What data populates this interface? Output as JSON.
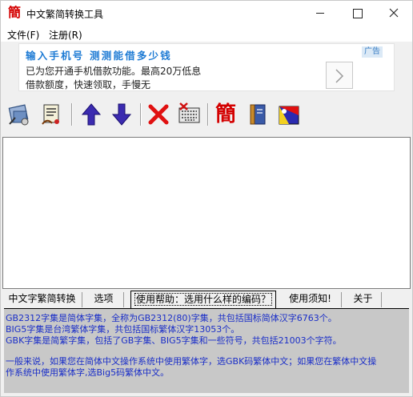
{
  "window": {
    "title": "中文繁简转换工具",
    "app_icon_glyph": "簡"
  },
  "menu": {
    "file": "文件(F)",
    "register": "注册(R)"
  },
  "ad": {
    "headline": "输入手机号  测测能借多少钱",
    "line1": "已为您开通手机借款功能。最高20万低息",
    "line2": "借款额度，快速领取，手慢无",
    "tag": "广告"
  },
  "toolbar": {
    "icons": [
      "open-file-icon",
      "convert-script-icon",
      "move-up-icon",
      "move-down-icon",
      "delete-icon",
      "keyboard-delete-icon",
      "simplified-char-icon",
      "book-icon",
      "flag-icon"
    ],
    "simplified_glyph": "簡"
  },
  "tabs": [
    "中文字繁简转换",
    "选项",
    "使用帮助：选用什么样的编码？",
    "使用须知!",
    "关于"
  ],
  "help": {
    "line1": "GB2312字集是简体字集，全称为GB2312(80)字集，共包括国标简体汉字6763个。",
    "line2": "BIG5字集是台湾繁体字集，共包括国标繁体汉字13053个。",
    "line3": "GBK字集是简繁字集，包括了GB字集、BIG5字集和一些符号，共包括21003个字符。",
    "line4": "一般来说，如果您在简体中文操作系统中使用繁体字，选GBK码繁体中文；如果您在繁体中文操",
    "line5": "作系统中使用繁体字,选Big5码繁体中文。"
  },
  "colors": {
    "ad_headline": "#1e7bd4",
    "help_text": "#1a2ec8",
    "help_bg": "#c8c8c8"
  }
}
